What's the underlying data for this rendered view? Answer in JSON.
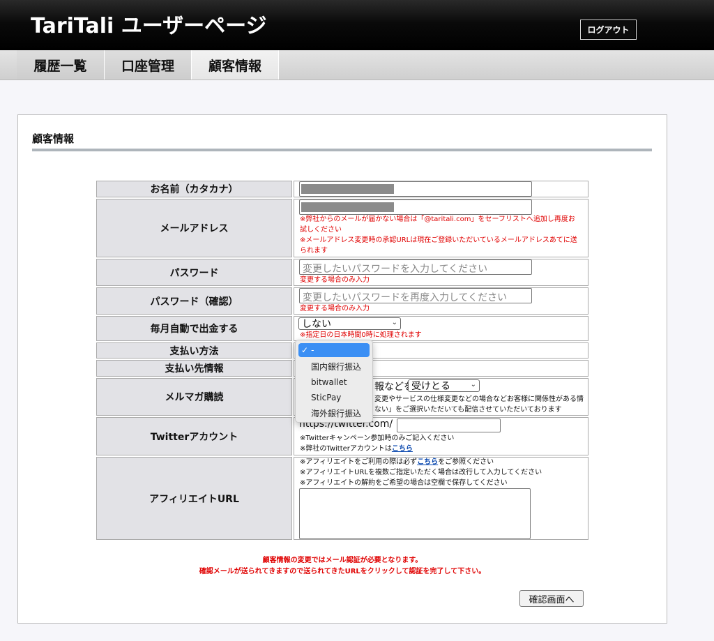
{
  "header": {
    "app_title": "TariTali ユーザーページ",
    "logout_label": "ログアウト"
  },
  "tabs": [
    {
      "label": "履歴一覧",
      "active": false
    },
    {
      "label": "口座管理",
      "active": false
    },
    {
      "label": "顧客情報",
      "active": true
    }
  ],
  "section": {
    "title": "顧客情報"
  },
  "form": {
    "name_kana": {
      "label": "お名前（カタカナ）",
      "value": "[redacted]"
    },
    "email": {
      "label": "メールアドレス",
      "value": "[redacted]",
      "note1": "※弊社からのメールが届かない場合は「@taritali.com」をセーフリストへ追加し再度お",
      "note1b": "試しください",
      "note2": "※メールアドレス変更時の承認URLは現在ご登録いただいているメールアドレスあてに送",
      "note2b": "られます"
    },
    "password": {
      "label": "パスワード",
      "placeholder": "変更したいパスワードを入力してください",
      "note": "変更する場合のみ入力"
    },
    "password_confirm": {
      "label": "パスワード（確認）",
      "placeholder": "変更したいパスワードを再度入力してください",
      "note": "変更する場合のみ入力"
    },
    "auto_withdraw": {
      "label": "毎月自動で出金する",
      "selected": "しない",
      "note": "※指定日の日本時間0時に処理されます"
    },
    "payment_method": {
      "label": "支払い方法",
      "options": [
        "-",
        "国内銀行振込",
        "bitwallet",
        "SticPay",
        "海外銀行振込"
      ],
      "selected": "-"
    },
    "payee_info": {
      "label": "支払い先情報"
    },
    "newsletter": {
      "label": "メルマガ購読",
      "prefix_visible": "報などを",
      "selected": "受けとる",
      "note_line1_visible": "変更やサービスの仕様変更などの場合などお客様に関係性がある情",
      "note_line2_visible": "ない」をご選択いただいても配信させていただいております"
    },
    "twitter": {
      "label": "Twitterアカウント",
      "prefix": "https://twitter.com/",
      "note1": "※Twitterキャンペーン参加時のみご記入ください",
      "note2_pre": "※弊社のTwitterアカウントは",
      "note2_link": "こちら"
    },
    "affiliate": {
      "label": "アフィリエイトURL",
      "note1_pre": "※アフィリエイトをご利用の際は必ず",
      "note1_link": "こちら",
      "note1_post": "をご参照ください",
      "note2": "※アフィリエイトURLを複数ご指定いただく場合は改行して入力してください",
      "note3": "※アフィリエイトの解約をご希望の場合は空欄で保存してください"
    }
  },
  "footer": {
    "note1": "顧客情報の変更ではメール認証が必要となります。",
    "note2": "確認メールが送られてきますので送られてきたURLをクリックして認証を完了して下さい。",
    "confirm_label": "確認画面へ"
  }
}
